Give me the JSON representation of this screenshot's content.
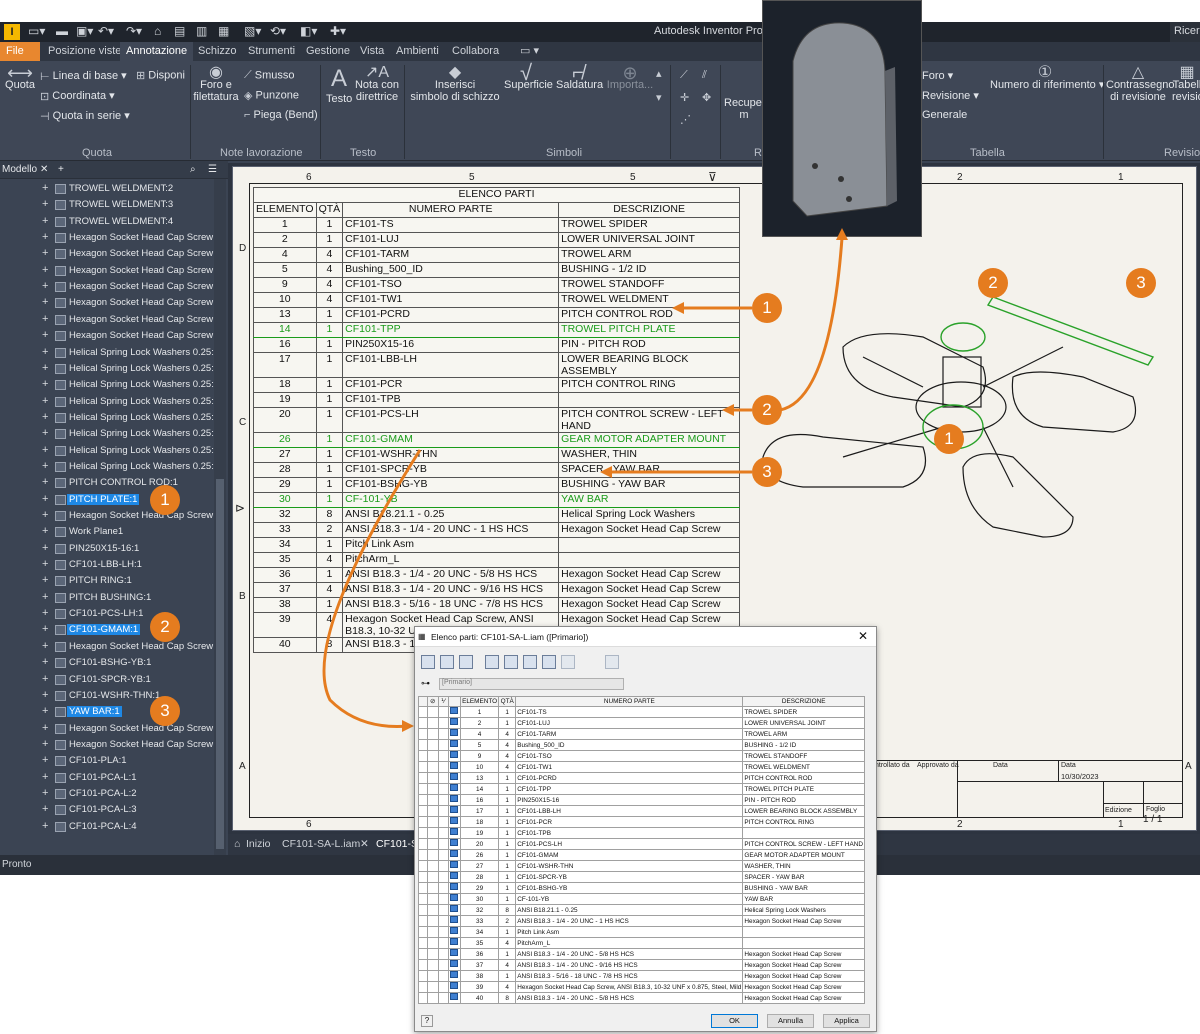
{
  "app": {
    "title": "Autodesk Inventor Profes",
    "account": "Ricer",
    "logo": "I"
  },
  "tabs": [
    "File",
    "Posizione viste",
    "Annotazione",
    "Schizzo",
    "Strumenti",
    "Gestione",
    "Vista",
    "Ambienti",
    "Collabora"
  ],
  "ribbon": {
    "quota": "Quota",
    "linea_base": "Linea di base",
    "disponi": "Disponi",
    "coordinata": "Coordinata",
    "quota_serie": "Quota in serie",
    "grp_quota": "Quota",
    "foro_filettatura_1": "Foro e",
    "foro_filettatura_2": "filettatura",
    "smusso": "Smusso",
    "punzone": "Punzone",
    "piega": "Piega (Bend)",
    "grp_note": "Note lavorazione",
    "testo": "Testo",
    "nota_1": "Nota con",
    "nota_2": "direttrice",
    "grp_testo": "Testo",
    "inserisci_1": "Inserisci",
    "inserisci_2": "simbolo di schizzo",
    "superficie": "Superficie",
    "saldatura": "Saldatura",
    "importa": "Importa...",
    "grp_simboli": "Simboli",
    "recuper": "Recuper",
    "recuper2": "m",
    "grp_r": "R",
    "foro": "Foro",
    "revisione": "Revisione",
    "generale": "Generale",
    "numero_rif": "Numero di riferimento",
    "grp_tabella": "Tabella",
    "contrassegno_1": "Contrassegno",
    "contrassegno_2": "di revisione",
    "tabell_1": "Tabell",
    "tabell_2": "revisio",
    "grp_revisione": "Revision"
  },
  "tree": {
    "header": "Modello",
    "items": [
      {
        "label": "TROWEL WELDMENT:2",
        "hl": false
      },
      {
        "label": "TROWEL WELDMENT:3",
        "hl": false
      },
      {
        "label": "TROWEL WELDMENT:4",
        "hl": false
      },
      {
        "label": "Hexagon Socket Head Cap Screw - I",
        "hl": false
      },
      {
        "label": "Hexagon Socket Head Cap Screw - I",
        "hl": false
      },
      {
        "label": "Hexagon Socket Head Cap Screw - I",
        "hl": false
      },
      {
        "label": "Hexagon Socket Head Cap Screw - I",
        "hl": false
      },
      {
        "label": "Hexagon Socket Head Cap Screw - I",
        "hl": false
      },
      {
        "label": "Hexagon Socket Head Cap Screw - I",
        "hl": false
      },
      {
        "label": "Hexagon Socket Head Cap Screw - I",
        "hl": false
      },
      {
        "label": "Helical Spring Lock Washers 0.25:1",
        "hl": false
      },
      {
        "label": "Helical Spring Lock Washers 0.25:2",
        "hl": false
      },
      {
        "label": "Helical Spring Lock Washers 0.25:3",
        "hl": false
      },
      {
        "label": "Helical Spring Lock Washers 0.25:4",
        "hl": false
      },
      {
        "label": "Helical Spring Lock Washers 0.25:5",
        "hl": false
      },
      {
        "label": "Helical Spring Lock Washers 0.25:6",
        "hl": false
      },
      {
        "label": "Helical Spring Lock Washers 0.25:7",
        "hl": false
      },
      {
        "label": "Helical Spring Lock Washers 0.25:8",
        "hl": false
      },
      {
        "label": "PITCH CONTROL ROD:1",
        "hl": false
      },
      {
        "label": "PITCH PLATE:1",
        "hl": true
      },
      {
        "label": "Hexagon Socket Head Cap Screw - I",
        "hl": false
      },
      {
        "label": "Work Plane1",
        "hl": false
      },
      {
        "label": "PIN250X15-16:1",
        "hl": false
      },
      {
        "label": "CF101-LBB-LH:1",
        "hl": false
      },
      {
        "label": "PITCH RING:1",
        "hl": false
      },
      {
        "label": "PITCH BUSHING:1",
        "hl": false
      },
      {
        "label": "CF101-PCS-LH:1",
        "hl": false
      },
      {
        "label": "CF101-GMAM:1",
        "hl": true
      },
      {
        "label": "Hexagon Socket Head Cap Screw - I",
        "hl": false
      },
      {
        "label": "CF101-BSHG-YB:1",
        "hl": false
      },
      {
        "label": "CF101-SPCR-YB:1",
        "hl": false
      },
      {
        "label": "CF101-WSHR-THN:1",
        "hl": false
      },
      {
        "label": "YAW BAR:1",
        "hl": true
      },
      {
        "label": "Hexagon Socket Head Cap Screw - I",
        "hl": false
      },
      {
        "label": "Hexagon Socket Head Cap Screw - I",
        "hl": false
      },
      {
        "label": "CF101-PLA:1",
        "hl": false
      },
      {
        "label": "CF101-PCA-L:1",
        "hl": false
      },
      {
        "label": "CF101-PCA-L:2",
        "hl": false
      },
      {
        "label": "CF101-PCA-L:3",
        "hl": false
      },
      {
        "label": "CF101-PCA-L:4",
        "hl": false
      }
    ]
  },
  "doctabs": {
    "home": "Inizio",
    "tab1": "CF101-SA-L.iam",
    "tab2": "CF101-S"
  },
  "status": "Pronto",
  "sheet": {
    "zones_top": [
      "6",
      "5",
      "4",
      "2",
      "1"
    ],
    "zones_left": [
      "D",
      "C",
      "B",
      "A"
    ],
    "plist_title": "ELENCO PARTI",
    "headers": [
      "ELEMENTO",
      "QTÀ",
      "NUMERO PARTE",
      "DESCRIZIONE"
    ],
    "rows": [
      [
        "1",
        "1",
        "CF101-TS",
        "TROWEL SPIDER"
      ],
      [
        "2",
        "1",
        "CF101-LUJ",
        "LOWER UNIVERSAL JOINT"
      ],
      [
        "4",
        "4",
        "CF101-TARM",
        "TROWEL ARM"
      ],
      [
        "5",
        "4",
        "Bushing_500_ID",
        "BUSHING - 1/2 ID"
      ],
      [
        "9",
        "4",
        "CF101-TSO",
        "TROWEL STANDOFF"
      ],
      [
        "10",
        "4",
        "CF101-TW1",
        "TROWEL WELDMENT"
      ],
      [
        "13",
        "1",
        "CF101-PCRD",
        "PITCH CONTROL ROD"
      ],
      [
        "14",
        "1",
        "CF101-TPP",
        "TROWEL PITCH PLATE"
      ],
      [
        "16",
        "1",
        "PIN250X15-16",
        "PIN - PITCH ROD"
      ],
      [
        "17",
        "1",
        "CF101-LBB-LH",
        "LOWER BEARING BLOCK ASSEMBLY"
      ],
      [
        "18",
        "1",
        "CF101-PCR",
        "PITCH CONTROL RING"
      ],
      [
        "19",
        "1",
        "CF101-TPB",
        ""
      ],
      [
        "20",
        "1",
        "CF101-PCS-LH",
        "PITCH CONTROL SCREW - LEFT HAND"
      ],
      [
        "26",
        "1",
        "CF101-GMAM",
        "GEAR MOTOR ADAPTER MOUNT"
      ],
      [
        "27",
        "1",
        "CF101-WSHR-THN",
        "WASHER, THIN"
      ],
      [
        "28",
        "1",
        "CF101-SPCR-YB",
        "SPACER - YAW BAR"
      ],
      [
        "29",
        "1",
        "CF101-BSHG-YB",
        "BUSHING - YAW BAR"
      ],
      [
        "30",
        "1",
        "CF-101-YB",
        "YAW BAR"
      ],
      [
        "32",
        "8",
        "ANSI B18.21.1 - 0.25",
        "Helical Spring Lock Washers"
      ],
      [
        "33",
        "2",
        "ANSI B18.3 - 1/4 - 20 UNC - 1 HS HCS",
        "Hexagon Socket Head Cap Screw"
      ],
      [
        "34",
        "1",
        "Pitch Link Asm",
        ""
      ],
      [
        "35",
        "4",
        "PitchArm_L",
        ""
      ],
      [
        "36",
        "1",
        "ANSI B18.3 - 1/4 - 20 UNC - 5/8 HS HCS",
        "Hexagon Socket Head Cap Screw"
      ],
      [
        "37",
        "4",
        "ANSI B18.3 - 1/4 - 20 UNC - 9/16 HS HCS",
        "Hexagon Socket Head Cap Screw"
      ],
      [
        "38",
        "1",
        "ANSI B18.3 - 5/16 - 18 UNC - 7/8 HS HCS",
        "Hexagon Socket Head Cap Screw"
      ],
      [
        "39",
        "4",
        "Hexagon Socket Head Cap Screw, ANSI B18.3, 10-32 UNF x 0.875, Steel, Mild",
        "Hexagon Socket Head Cap Screw"
      ],
      [
        "40",
        "8",
        "ANSI B18.3 - 1/4 - 20 UNC - 5/8 HS HCS",
        "Hexagon Socket Head Cap Screw"
      ]
    ],
    "selected_rows": [
      "14",
      "26",
      "30"
    ],
    "titleblock": {
      "controllato": "ntrollato da",
      "approvato": "Approvato da",
      "data_lbl": "Data",
      "data_lbl2": "Data",
      "date": "10/30/2023",
      "edizione": "Edizione",
      "foglio": "Foglio",
      "foglio_val": "1 / 1"
    }
  },
  "callouts": [
    "1",
    "2",
    "3"
  ],
  "dialog": {
    "title": "Elenco parti: CF101-SA-L.iam ([Primario])",
    "close": "✕",
    "combo": "[Primario]",
    "headers": [
      "",
      "",
      "",
      "ELEMENTO",
      "QTÀ",
      "NUMERO PARTE",
      "DESCRIZIONE"
    ],
    "rows": [
      [
        "1",
        "1",
        "CF101-TS",
        "TROWEL SPIDER"
      ],
      [
        "2",
        "1",
        "CF101-LUJ",
        "LOWER UNIVERSAL JOINT"
      ],
      [
        "4",
        "4",
        "CF101-TARM",
        "TROWEL ARM"
      ],
      [
        "5",
        "4",
        "Bushing_500_ID",
        "BUSHING - 1/2 ID"
      ],
      [
        "9",
        "4",
        "CF101-TSO",
        "TROWEL STANDOFF"
      ],
      [
        "10",
        "4",
        "CF101-TW1",
        "TROWEL WELDMENT"
      ],
      [
        "13",
        "1",
        "CF101-PCRD",
        "PITCH CONTROL ROD"
      ],
      [
        "14",
        "1",
        "CF101-TPP",
        "TROWEL PITCH PLATE"
      ],
      [
        "16",
        "1",
        "PIN250X15-16",
        "PIN - PITCH ROD"
      ],
      [
        "17",
        "1",
        "CF101-LBB-LH",
        "LOWER BEARING BLOCK ASSEMBLY"
      ],
      [
        "18",
        "1",
        "CF101-PCR",
        "PITCH CONTROL RING"
      ],
      [
        "19",
        "1",
        "CF101-TPB",
        ""
      ],
      [
        "20",
        "1",
        "CF101-PCS-LH",
        "PITCH CONTROL SCREW - LEFT HAND"
      ],
      [
        "26",
        "1",
        "CF101-GMAM",
        "GEAR MOTOR ADAPTER MOUNT"
      ],
      [
        "27",
        "1",
        "CF101-WSHR-THN",
        "WASHER, THIN"
      ],
      [
        "28",
        "1",
        "CF101-SPCR-YB",
        "SPACER - YAW BAR"
      ],
      [
        "29",
        "1",
        "CF101-BSHG-YB",
        "BUSHING - YAW BAR"
      ],
      [
        "30",
        "1",
        "CF-101-YB",
        "YAW BAR"
      ],
      [
        "32",
        "8",
        "ANSI B18.21.1 - 0.25",
        "Helical Spring Lock Washers"
      ],
      [
        "33",
        "2",
        "ANSI B18.3 - 1/4 - 20 UNC - 1 HS HCS",
        "Hexagon Socket Head Cap Screw"
      ],
      [
        "34",
        "1",
        "Pitch Link Asm",
        ""
      ],
      [
        "35",
        "4",
        "PitchArm_L",
        ""
      ],
      [
        "36",
        "1",
        "ANSI B18.3 - 1/4 - 20 UNC - 5/8 HS HCS",
        "Hexagon Socket Head Cap Screw"
      ],
      [
        "37",
        "4",
        "ANSI B18.3 - 1/4 - 20 UNC - 9/16 HS HCS",
        "Hexagon Socket Head Cap Screw"
      ],
      [
        "38",
        "1",
        "ANSI B18.3 - 5/16 - 18 UNC - 7/8 HS HCS",
        "Hexagon Socket Head Cap Screw"
      ],
      [
        "39",
        "4",
        "Hexagon Socket Head Cap Screw, ANSI B18.3, 10-32 UNF x 0.875, Steel, Mild",
        "Hexagon Socket Head Cap Screw"
      ],
      [
        "40",
        "8",
        "ANSI B18.3 - 1/4 - 20 UNC - 5/8 HS HCS",
        "Hexagon Socket Head Cap Screw"
      ]
    ],
    "ok": "OK",
    "annulla": "Annulla",
    "applica": "Applica",
    "help": "?"
  },
  "colors": {
    "accent": "#e57c1f",
    "selection": "#1a9b1a",
    "highlight": "#1e88e5"
  }
}
